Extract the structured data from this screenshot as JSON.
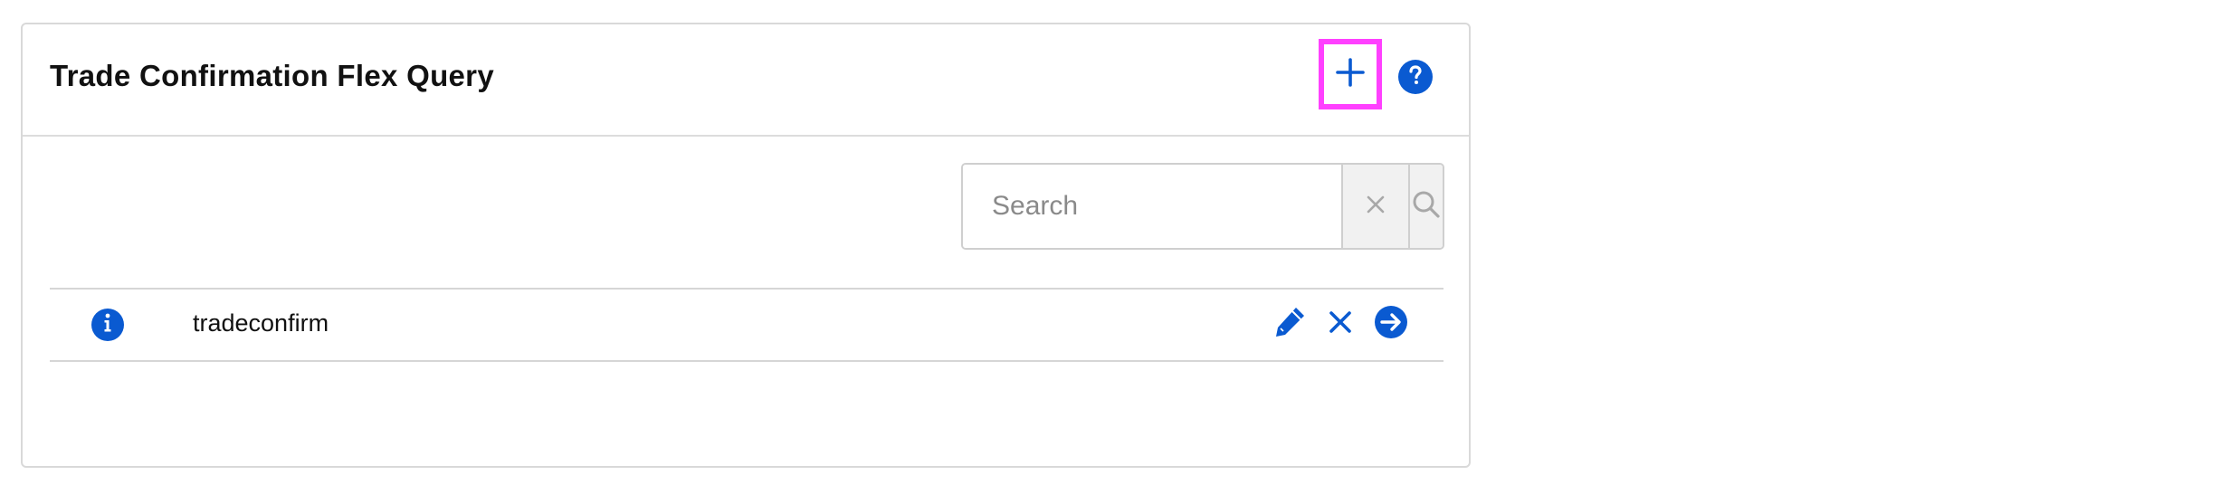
{
  "panel": {
    "title": "Trade Confirmation Flex Query",
    "add_icon": "plus-icon",
    "help_icon": "question-circle-icon"
  },
  "search": {
    "placeholder": "Search",
    "value": "",
    "clear_icon": "close-icon",
    "submit_icon": "search-icon"
  },
  "queries": [
    {
      "name": "tradeconfirm",
      "info_icon": "info-circle-icon",
      "edit_icon": "pencil-icon",
      "delete_icon": "close-icon",
      "run_icon": "arrow-right-circle-icon"
    }
  ],
  "colors": {
    "accent": "#0a5ad1",
    "highlight": "#ff40ff"
  }
}
